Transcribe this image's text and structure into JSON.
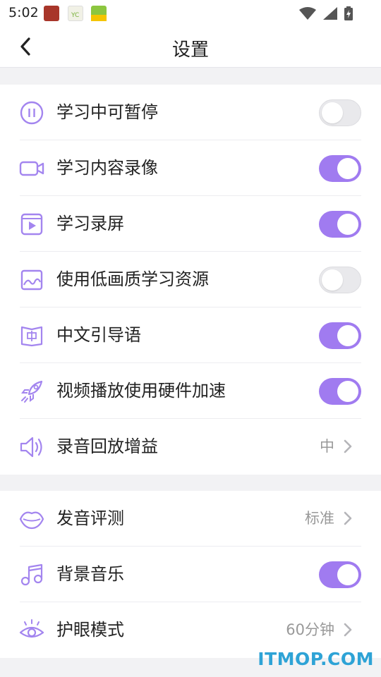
{
  "status_bar": {
    "time": "5:02",
    "app_icons": [
      "app-icon-1",
      "app-icon-2",
      "app-icon-3"
    ]
  },
  "header": {
    "title": "设置",
    "back_icon": "chevron-left-icon"
  },
  "colors": {
    "accent": "#a07bf0",
    "icon": "#a385ef",
    "toggle_off": "#e9e9ec",
    "watermark": "#2ea3d6"
  },
  "group1": {
    "items": [
      {
        "label": "学习中可暂停",
        "icon": "pause-circle-icon",
        "toggle": false
      },
      {
        "label": "学习内容录像",
        "icon": "video-camera-icon",
        "toggle": true
      },
      {
        "label": "学习录屏",
        "icon": "screen-record-icon",
        "toggle": true
      },
      {
        "label": "使用低画质学习资源",
        "icon": "image-icon",
        "toggle": false
      },
      {
        "label": "中文引导语",
        "icon": "book-chinese-icon",
        "toggle": true
      },
      {
        "label": "视频播放使用硬件加速",
        "icon": "rocket-icon",
        "toggle": true
      },
      {
        "label": "录音回放增益",
        "icon": "speaker-icon",
        "value": "中"
      }
    ]
  },
  "group2": {
    "items": [
      {
        "label": "发音评测",
        "icon": "lips-icon",
        "value": "标准"
      },
      {
        "label": "背景音乐",
        "icon": "music-note-icon",
        "toggle": true
      },
      {
        "label": "护眼模式",
        "icon": "eye-icon",
        "value": "60分钟"
      }
    ]
  },
  "watermark": "ITMOP.COM"
}
